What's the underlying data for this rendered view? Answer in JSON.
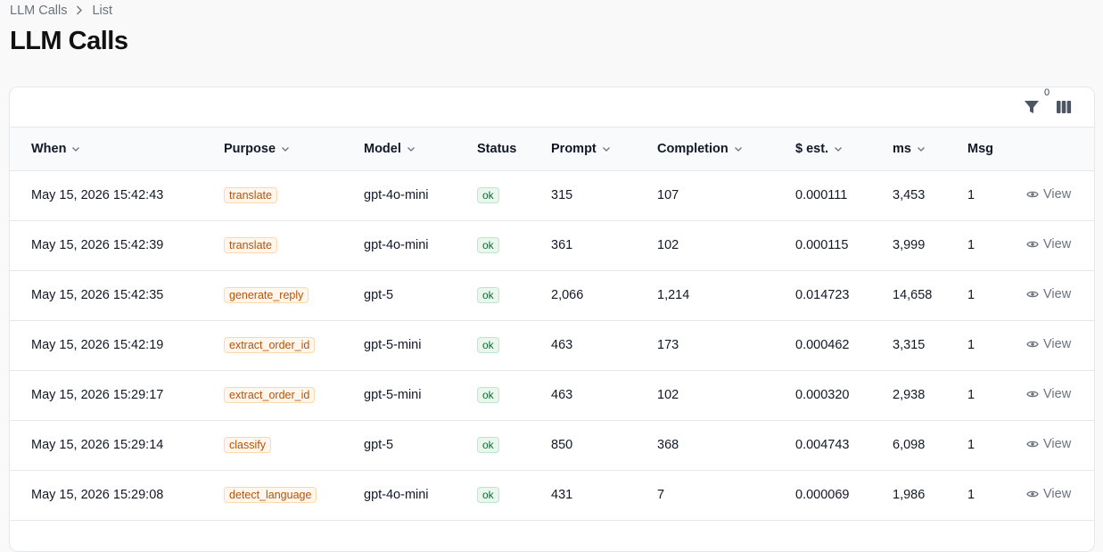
{
  "breadcrumb": {
    "root": "LLM Calls",
    "current": "List"
  },
  "page_title": "LLM Calls",
  "toolbar": {
    "filter_count": "0"
  },
  "columns": {
    "when": "When",
    "purpose": "Purpose",
    "model": "Model",
    "status": "Status",
    "prompt": "Prompt",
    "completion": "Completion",
    "cost": "$ est.",
    "ms": "ms",
    "msg": "Msg"
  },
  "view_label": "View",
  "rows": [
    {
      "when": "May 15, 2026 15:42:43",
      "purpose": "translate",
      "model": "gpt-4o-mini",
      "status": "ok",
      "prompt": "315",
      "completion": "107",
      "cost": "0.000111",
      "ms": "3,453",
      "msg": "1"
    },
    {
      "when": "May 15, 2026 15:42:39",
      "purpose": "translate",
      "model": "gpt-4o-mini",
      "status": "ok",
      "prompt": "361",
      "completion": "102",
      "cost": "0.000115",
      "ms": "3,999",
      "msg": "1"
    },
    {
      "when": "May 15, 2026 15:42:35",
      "purpose": "generate_reply",
      "model": "gpt-5",
      "status": "ok",
      "prompt": "2,066",
      "completion": "1,214",
      "cost": "0.014723",
      "ms": "14,658",
      "msg": "1"
    },
    {
      "when": "May 15, 2026 15:42:19",
      "purpose": "extract_order_id",
      "model": "gpt-5-mini",
      "status": "ok",
      "prompt": "463",
      "completion": "173",
      "cost": "0.000462",
      "ms": "3,315",
      "msg": "1"
    },
    {
      "when": "May 15, 2026 15:29:17",
      "purpose": "extract_order_id",
      "model": "gpt-5-mini",
      "status": "ok",
      "prompt": "463",
      "completion": "102",
      "cost": "0.000320",
      "ms": "2,938",
      "msg": "1"
    },
    {
      "when": "May 15, 2026 15:29:14",
      "purpose": "classify",
      "model": "gpt-5",
      "status": "ok",
      "prompt": "850",
      "completion": "368",
      "cost": "0.004743",
      "ms": "6,098",
      "msg": "1"
    },
    {
      "when": "May 15, 2026 15:29:08",
      "purpose": "detect_language",
      "model": "gpt-4o-mini",
      "status": "ok",
      "prompt": "431",
      "completion": "7",
      "cost": "0.000069",
      "ms": "1,986",
      "msg": "1"
    }
  ],
  "colors": {
    "purpose_text": "#b45309",
    "status_text": "#166534",
    "muted": "#6b7280"
  },
  "icons": {
    "filter": "filter-icon",
    "columns": "columns-icon",
    "sort": "chevron-down-icon",
    "view": "eye-icon"
  }
}
